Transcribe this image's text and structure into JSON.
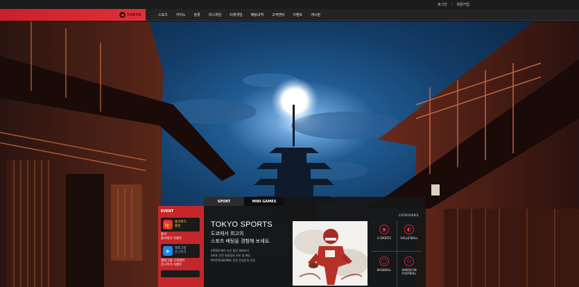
{
  "topbar": {
    "login": "로그인",
    "register": "회원가입"
  },
  "logo": {
    "text": "TOKYO"
  },
  "nav": [
    {
      "label": "스포츠"
    },
    {
      "label": "카지노"
    },
    {
      "label": "슬롯"
    },
    {
      "label": "미니게임"
    },
    {
      "label": "티켓게임"
    },
    {
      "label": "배팅내역"
    },
    {
      "label": "고객센터"
    },
    {
      "label": "이벤트"
    },
    {
      "label": "게시판"
    }
  ],
  "event": {
    "title": "EVENT",
    "items": [
      {
        "badge": "출석체크\n룰렛",
        "caption": "출석\n출석체크 이벤트",
        "color": "#e03036",
        "icon": "gift-icon"
      },
      {
        "badge": "텔레그램\n친구추가",
        "caption": "텔레그램 고객센터\n친구추가 이벤트",
        "color": "#1e88e5",
        "icon": "telegram-icon"
      }
    ]
  },
  "sport": {
    "tabs": [
      {
        "label": "SPORT"
      },
      {
        "label": "MINI GAMES"
      }
    ],
    "title": "TOKYO SPORTS",
    "sub1": "도쿄에서 최고의",
    "sub2": "스포츠 배팅을 경험해 보세요.",
    "desc": [
      "SPEED 빠른 승인 환전 결제처리",
      "SAFE 안전 회원정보 처리 및 배팅",
      "PROFESSIONAL 전문 운영진의 운영"
    ],
    "categories_title": "CATEGORIES",
    "categories": [
      {
        "label": "E-SPORTS",
        "icon": "gamepad-icon"
      },
      {
        "label": "VOLLEYBALL",
        "icon": "volleyball-icon"
      },
      {
        "label": "BASEBALL",
        "icon": "baseball-icon"
      },
      {
        "label": "AMERICAN\nFOOTBALL",
        "icon": "football-icon"
      }
    ]
  },
  "colors": {
    "accent": "#e03036",
    "nav_bg": "#232323",
    "panel_bg": "#161616"
  }
}
